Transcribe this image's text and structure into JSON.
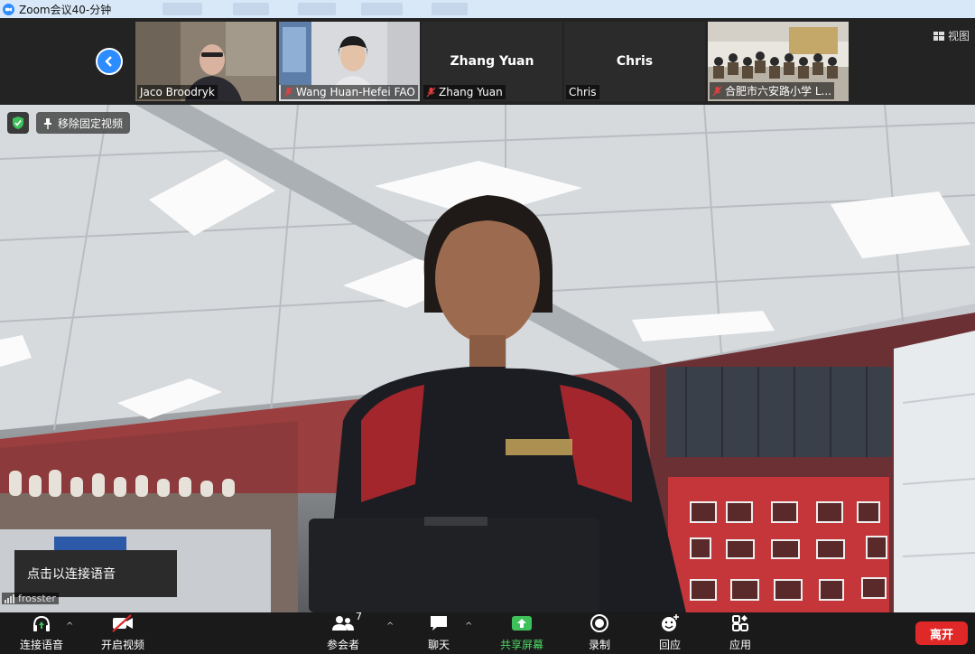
{
  "window": {
    "title": "Zoom会议40-分钟"
  },
  "strip": {
    "view_label": "视图",
    "participants": [
      {
        "name": "Jaco Broodryk",
        "muted": false,
        "has_video": true
      },
      {
        "name": "Wang Huan-Hefei FAO",
        "muted": true,
        "has_video": true
      },
      {
        "name": "Zhang Yuan",
        "muted": true,
        "has_video": false,
        "display_name": "Zhang Yuan"
      },
      {
        "name": "Chris",
        "muted": false,
        "has_video": false,
        "display_name": "Chris"
      },
      {
        "name": "合肥市六安路小学 L...",
        "muted": true,
        "has_video": true
      }
    ]
  },
  "main": {
    "unpin_label": "移除固定视频",
    "connect_audio_popup": "点击以连接语音",
    "speaker_name": "frosster"
  },
  "toolbar": {
    "audio_label": "连接语音",
    "video_label": "开启视频",
    "participants_label": "参会者",
    "participants_count": "7",
    "chat_label": "聊天",
    "share_label": "共享屏幕",
    "record_label": "录制",
    "reactions_label": "回应",
    "apps_label": "应用",
    "leave_label": "离开"
  },
  "colors": {
    "accent": "#2d8cff",
    "share_green": "#4cd964",
    "leave_red": "#e02828",
    "toolbar_bg": "#1a1a1a"
  }
}
